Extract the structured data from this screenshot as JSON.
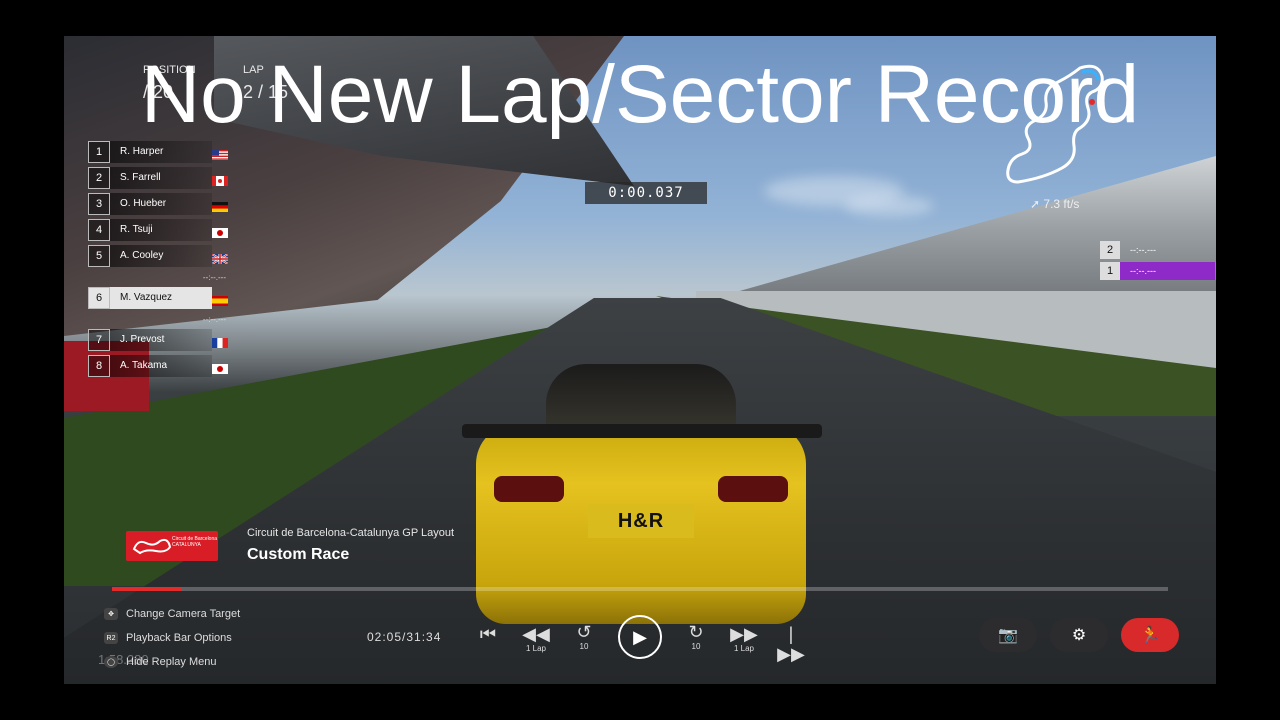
{
  "overlay_caption": "No New Lap/Sector Record",
  "hud": {
    "position_label": "POSITION",
    "position_value": "/ 20",
    "lap_label": "LAP",
    "lap_value": "2 / 15",
    "timer": "0:00.037",
    "speed": "7.3 ft/s"
  },
  "leaderboard": [
    {
      "pos": "1",
      "name": "R. Harper",
      "flag": "us-flag"
    },
    {
      "pos": "2",
      "name": "S. Farrell",
      "flag": "ca-flag"
    },
    {
      "pos": "3",
      "name": "O. Hueber",
      "flag": "de-flag"
    },
    {
      "pos": "4",
      "name": "R. Tsuji",
      "flag": "jp-flag"
    },
    {
      "pos": "5",
      "name": "A. Cooley",
      "flag": "gb-flag"
    },
    {
      "gap": "--:--.---"
    },
    {
      "pos": "6",
      "name": "M. Vazquez",
      "flag": "es-flag",
      "player": true
    },
    {
      "gap": "--:--.---"
    },
    {
      "pos": "7",
      "name": "J. Prevost",
      "flag": "fr-flag"
    },
    {
      "pos": "8",
      "name": "A. Takama",
      "flag": "jp-flag"
    }
  ],
  "rivals": [
    {
      "pos": "2",
      "time": "--:--.---"
    },
    {
      "pos": "1",
      "time": "--:--.---"
    }
  ],
  "track": {
    "logo_text": "Circuit de Barcelona CATALUNYA",
    "layout": "Circuit de Barcelona-Catalunya GP Layout",
    "race": "Custom Race"
  },
  "replay": {
    "progress": 0.066,
    "time": "02:05/31:34",
    "rewind_label": "1 Lap",
    "ff_label": "1 Lap",
    "skip_back_10": "10",
    "skip_fwd_10": "10"
  },
  "hints": {
    "camera": "Change Camera Target",
    "playback_button": "R2",
    "playback": "Playback Bar Options",
    "hide": "Hide Replay Menu"
  },
  "ghost_number": "1:58.280",
  "colors": {
    "accent_red": "#d82a2a",
    "rival_highlight": "#8e2ac8"
  }
}
